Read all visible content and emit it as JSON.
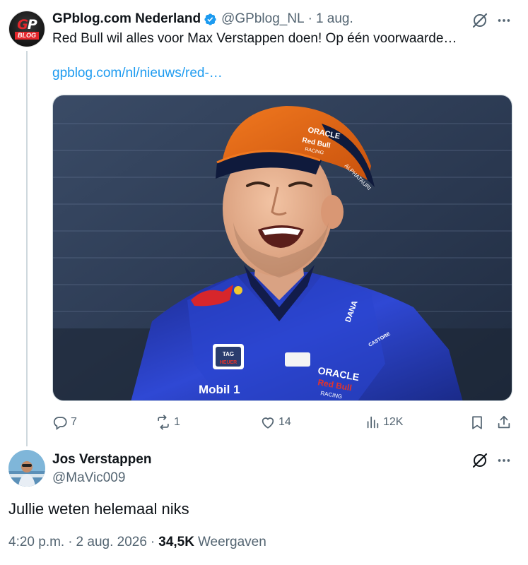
{
  "tweet1": {
    "author_name": "GPblog.com Nederland",
    "author_handle": "@GPblog_NL",
    "separator": "·",
    "time": "1 aug.",
    "text": "Red Bull wil alles voor Max Verstappen doen! Op één voorwaarde…",
    "link": "gpblog.com/nl/nieuws/red-…",
    "avatar": {
      "line1_a": "G",
      "line1_b": "P",
      "line2": "BLOG"
    },
    "photo": {
      "cap_text_1": "ORACLE",
      "cap_text_2": "Red Bull",
      "cap_text_3": "RACING",
      "cap_side": "ALPHATAURI",
      "badge_tag": "TAG",
      "badge_heuer": "HEUER",
      "mobil": "Mobil 1",
      "oracle": "ORACLE",
      "redbull_racing": "Red Bull",
      "racing": "RACING",
      "dana": "DANA",
      "castore": "CASTORE"
    },
    "actions": {
      "replies": "7",
      "reposts": "1",
      "likes": "14",
      "views": "12K"
    }
  },
  "tweet2": {
    "author_name": "Jos Verstappen",
    "author_handle": "@MaVic009",
    "text": "Jullie weten helemaal niks",
    "time": "4:20 p.m.",
    "separator": "·",
    "date": "2 aug. 2026",
    "separator2": "·",
    "views_count": "34,5K",
    "views_label": "Weergaven"
  },
  "colors": {
    "text": "#0f1419",
    "secondary": "#536471",
    "link": "#1d9bf0",
    "verified": "#1d9bf0",
    "border": "#cfd9de"
  },
  "icons": {
    "verified": "verified-badge-icon",
    "grok": "grok-icon",
    "more": "more-icon",
    "reply": "reply-icon",
    "repost": "repost-icon",
    "like": "heart-icon",
    "views": "views-icon",
    "bookmark": "bookmark-icon",
    "share": "share-icon"
  }
}
